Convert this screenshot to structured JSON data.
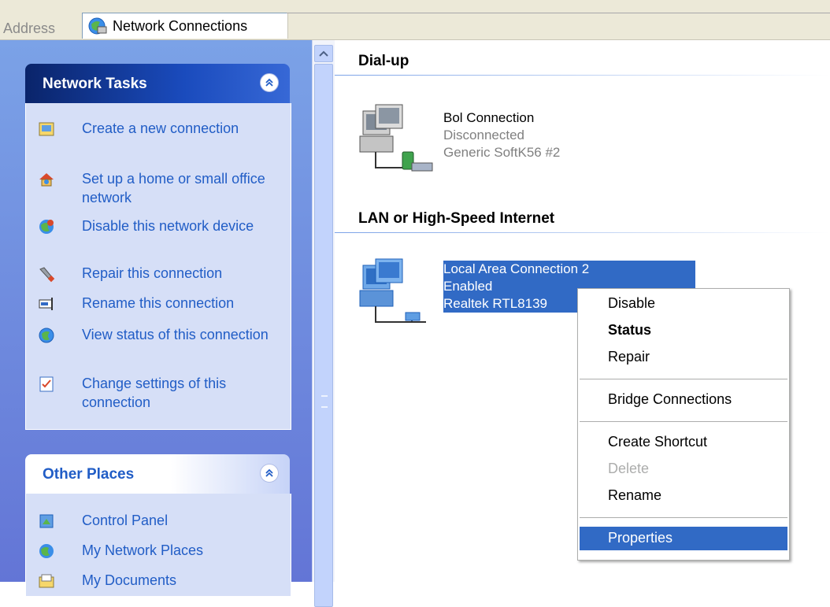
{
  "address": {
    "label": "Address",
    "value": "Network Connections"
  },
  "network_tasks": {
    "title": "Network Tasks",
    "items": [
      {
        "label": "Create a new connection"
      },
      {
        "label": "Set up a home or small office network"
      },
      {
        "label": "Disable this network device"
      },
      {
        "label": "Repair this connection"
      },
      {
        "label": "Rename this connection"
      },
      {
        "label": "View status of this connection"
      },
      {
        "label": "Change settings of this connection"
      }
    ]
  },
  "other_places": {
    "title": "Other Places",
    "items": [
      {
        "label": "Control Panel"
      },
      {
        "label": "My Network Places"
      },
      {
        "label": "My Documents"
      }
    ]
  },
  "groups": {
    "dialup": {
      "title": "Dial-up",
      "connection": {
        "name": "Bol Connection",
        "status": "Disconnected",
        "device": "Generic SoftK56 #2"
      }
    },
    "lan": {
      "title": "LAN or High-Speed Internet",
      "connection": {
        "name": "Local Area Connection 2",
        "status": "Enabled",
        "device": "Realtek RTL8139"
      }
    }
  },
  "context_menu": {
    "items": [
      "Disable",
      "Status",
      "Repair",
      "Bridge Connections",
      "Create Shortcut",
      "Delete",
      "Rename",
      "Properties"
    ]
  },
  "colors": {
    "selection": "#316ac5",
    "task_link": "#215dc6",
    "task_panel": "#d6dff7"
  }
}
